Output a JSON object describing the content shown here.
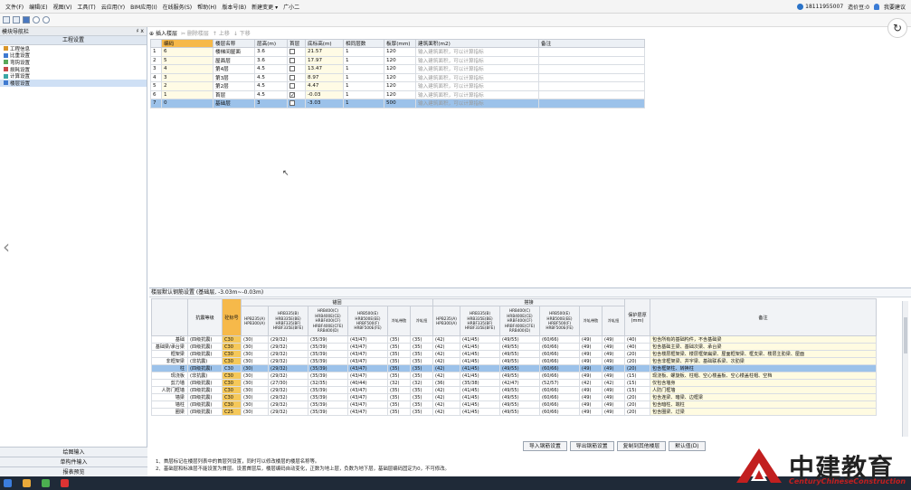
{
  "menu": [
    "文件(F)",
    "编辑(E)",
    "视图(V)",
    "工具(T)",
    "云应用(Y)",
    "BIM应用(I)",
    "在线服务(S)",
    "帮助(H)",
    "版本号(B)",
    "新建变更 ▾",
    "广小二"
  ],
  "account": {
    "phone": "18111955007",
    "gold": "造价豆:0",
    "feedback": "我要建议"
  },
  "left_panel": {
    "title": "模块导航栏",
    "pin": "♯ x",
    "section": "工程设置",
    "items": [
      "工程信息",
      "比重设置",
      "弯钩设置",
      "损耗设置",
      "计算设置",
      "楼层设置"
    ],
    "bottom_buttons": [
      "绘图输入",
      "单构件输入",
      "报表预览"
    ]
  },
  "floor_toolbar": {
    "insert": "插入楼层",
    "delete": "删除楼层",
    "up": "上移",
    "down": "下移"
  },
  "floor_headers": [
    "",
    "编码",
    "楼层名称",
    "层高(m)",
    "首层",
    "底标高(m)",
    "相同层数",
    "板厚(mm)",
    "建筑面积(m2)",
    "备注"
  ],
  "floors": [
    {
      "no": "1",
      "code": "6",
      "name": "楼梯间屋面",
      "height": "3.6",
      "first": false,
      "bottom": "21.57",
      "same": "1",
      "slab": "120",
      "area": "输入建筑面积，可以计算指标"
    },
    {
      "no": "2",
      "code": "5",
      "name": "屋面层",
      "height": "3.6",
      "first": false,
      "bottom": "17.97",
      "same": "1",
      "slab": "120",
      "area": "输入建筑面积，可以计算指标"
    },
    {
      "no": "3",
      "code": "4",
      "name": "第4层",
      "height": "4.5",
      "first": false,
      "bottom": "13.47",
      "same": "1",
      "slab": "120",
      "area": "输入建筑面积，可以计算指标"
    },
    {
      "no": "4",
      "code": "3",
      "name": "第3层",
      "height": "4.5",
      "first": false,
      "bottom": "8.97",
      "same": "1",
      "slab": "120",
      "area": "输入建筑面积，可以计算指标"
    },
    {
      "no": "5",
      "code": "2",
      "name": "第2层",
      "height": "4.5",
      "first": false,
      "bottom": "4.47",
      "same": "1",
      "slab": "120",
      "area": "输入建筑面积，可以计算指标"
    },
    {
      "no": "6",
      "code": "1",
      "name": "首层",
      "height": "4.5",
      "first": true,
      "bottom": "-0.03",
      "same": "1",
      "slab": "120",
      "area": "输入建筑面积，可以计算指标"
    },
    {
      "no": "7",
      "code": "0",
      "name": "基础层",
      "height": "3",
      "first": false,
      "bottom": "-3.03",
      "same": "1",
      "slab": "500",
      "area": "输入建筑面积，可以计算指标"
    }
  ],
  "rebar_panel": {
    "caption": "楼层默认钢筋设置 (基础层, -3.03m~-0.03m)",
    "group_anchor": "锚固",
    "group_lap": "搭接",
    "col_seismic": "抗震等级",
    "col_concrete": "砼标号",
    "anchor_cols": [
      "HPB235(A)\nHPB300(A)",
      "HRB335(B)\nHRB335E(BE)\nHRBF335(BF)\nHRBF335E(BFE)",
      "HRB400(C)\nHRB400E(CE)\nHRBF400(CF)\nHRBF400E(CFE)\nRRB400(D)",
      "HRB500(E)\nHRB500E(EE)\nHRBF500(F)\nHRBF500E(FE)",
      "冷轧带肋",
      "冷轧扭"
    ],
    "lap_cols": [
      "HPB235(A)\nHPB300(A)",
      "HRB335(B)\nHRB335E(BE)\nHRBF335(BF)\nHRBF335E(BFE)",
      "HRB400(C)\nHRB400E(CE)\nHRBF400(CF)\nHRBF400E(CFE)\nRRB400(D)",
      "HRB500(E)\nHRB500E(EE)\nHRBF500(F)\nHRBF500E(FE)",
      "冷轧带肋",
      "冷轧扭"
    ],
    "col_cover": "保护层厚(mm)",
    "col_note": "备注",
    "rows": [
      {
        "name": "基础",
        "seismic": "(四级抗震)",
        "conc": "C30",
        "a": [
          "(30)",
          "(29/32)",
          "(35/39)",
          "(43/47)",
          "(35)",
          "(35)"
        ],
        "l": [
          "(42)",
          "(41/45)",
          "(49/55)",
          "(60/66)",
          "(49)",
          "(49)"
        ],
        "cover": "(40)",
        "note": "包含所有的基础构件，不含基础梁"
      },
      {
        "name": "基础梁/承台梁",
        "seismic": "(四级抗震)",
        "conc": "C30",
        "a": [
          "(30)",
          "(29/32)",
          "(35/39)",
          "(43/47)",
          "(35)",
          "(35)"
        ],
        "l": [
          "(42)",
          "(41/45)",
          "(49/55)",
          "(60/66)",
          "(49)",
          "(49)"
        ],
        "cover": "(40)",
        "note": "包含基础主梁、基础次梁、承台梁"
      },
      {
        "name": "框架梁",
        "seismic": "(四级抗震)",
        "conc": "C30",
        "a": [
          "(30)",
          "(29/32)",
          "(35/39)",
          "(43/47)",
          "(35)",
          "(35)"
        ],
        "l": [
          "(42)",
          "(41/45)",
          "(49/55)",
          "(60/66)",
          "(49)",
          "(49)"
        ],
        "cover": "(20)",
        "note": "包含楼层框架梁、楼层框架扁梁、屋面框架梁、框支梁、楼层主肋梁、屋面"
      },
      {
        "name": "非框架梁",
        "seismic": "(非抗震)",
        "conc": "C30",
        "a": [
          "(30)",
          "(29/32)",
          "(35/39)",
          "(43/47)",
          "(35)",
          "(35)"
        ],
        "l": [
          "(42)",
          "(41/45)",
          "(49/55)",
          "(60/66)",
          "(49)",
          "(49)"
        ],
        "cover": "(20)",
        "note": "包含非框架梁、井字梁、基础联系梁、次肋梁"
      },
      {
        "name": "柱",
        "seismic": "(四级抗震)",
        "conc": "C30",
        "a": [
          "(30)",
          "(29/32)",
          "(35/39)",
          "(43/47)",
          "(35)",
          "(35)"
        ],
        "l": [
          "(42)",
          "(41/45)",
          "(49/55)",
          "(60/66)",
          "(49)",
          "(49)"
        ],
        "cover": "(20)",
        "note": "包含框架柱、转换柱",
        "sel": true
      },
      {
        "name": "现浇板",
        "seismic": "(非抗震)",
        "conc": "C30",
        "a": [
          "(30)",
          "(29/32)",
          "(35/39)",
          "(43/47)",
          "(35)",
          "(35)"
        ],
        "l": [
          "(42)",
          "(41/45)",
          "(49/55)",
          "(60/66)",
          "(49)",
          "(49)"
        ],
        "cover": "(15)",
        "note": "现浇板、螺旋板、柱帽、空心楼盖板、空心楼盖柱帽、空档"
      },
      {
        "name": "剪力墙",
        "seismic": "(四级抗震)",
        "conc": "C30",
        "a": [
          "(30)",
          "(27/30)",
          "(32/35)",
          "(40/44)",
          "(32)",
          "(32)"
        ],
        "l": [
          "(36)",
          "(35/38)",
          "(42/47)",
          "(52/57)",
          "(42)",
          "(42)"
        ],
        "cover": "(15)",
        "note": "仅包含墙身"
      },
      {
        "name": "人防门框墙",
        "seismic": "(四级抗震)",
        "conc": "C30",
        "a": [
          "(30)",
          "(29/32)",
          "(35/39)",
          "(43/47)",
          "(35)",
          "(35)"
        ],
        "l": [
          "(42)",
          "(41/45)",
          "(49/55)",
          "(60/66)",
          "(49)",
          "(49)"
        ],
        "cover": "(15)",
        "note": "人防门框墙"
      },
      {
        "name": "墙梁",
        "seismic": "(四级抗震)",
        "conc": "C30",
        "a": [
          "(30)",
          "(29/32)",
          "(35/39)",
          "(43/47)",
          "(35)",
          "(35)"
        ],
        "l": [
          "(42)",
          "(41/45)",
          "(49/55)",
          "(60/66)",
          "(49)",
          "(49)"
        ],
        "cover": "(20)",
        "note": "包含连梁、暗梁、边框梁"
      },
      {
        "name": "墙柱",
        "seismic": "(四级抗震)",
        "conc": "C30",
        "a": [
          "(30)",
          "(29/32)",
          "(35/39)",
          "(43/47)",
          "(35)",
          "(35)"
        ],
        "l": [
          "(42)",
          "(41/45)",
          "(49/55)",
          "(60/66)",
          "(49)",
          "(49)"
        ],
        "cover": "(20)",
        "note": "包含暗柱、端柱"
      },
      {
        "name": "圈梁",
        "seismic": "(四级抗震)",
        "conc": "C25",
        "a": [
          "(30)",
          "(29/32)",
          "(35/39)",
          "(43/47)",
          "(35)",
          "(35)"
        ],
        "l": [
          "(42)",
          "(41/45)",
          "(49/55)",
          "(60/66)",
          "(49)",
          "(49)"
        ],
        "cover": "(20)",
        "note": "包含圈梁、过梁"
      }
    ]
  },
  "buttons": [
    "导入钢筋设置",
    "导出钢筋设置",
    "复制到其他楼层",
    "默认值(D)"
  ],
  "tips": [
    "1、首层标记在楼层列表中的首层列设置，同时可以修改楼层的楼层名称等。",
    "2、基础层和标准层不能设置为首层。设置首层后，楼层编码自动变化，正数为地上层，负数为地下层，基础层编码固定为0，不可修改。"
  ],
  "watermark": {
    "text": "中建教育",
    "sub": "CenturyChineseConstruction"
  }
}
